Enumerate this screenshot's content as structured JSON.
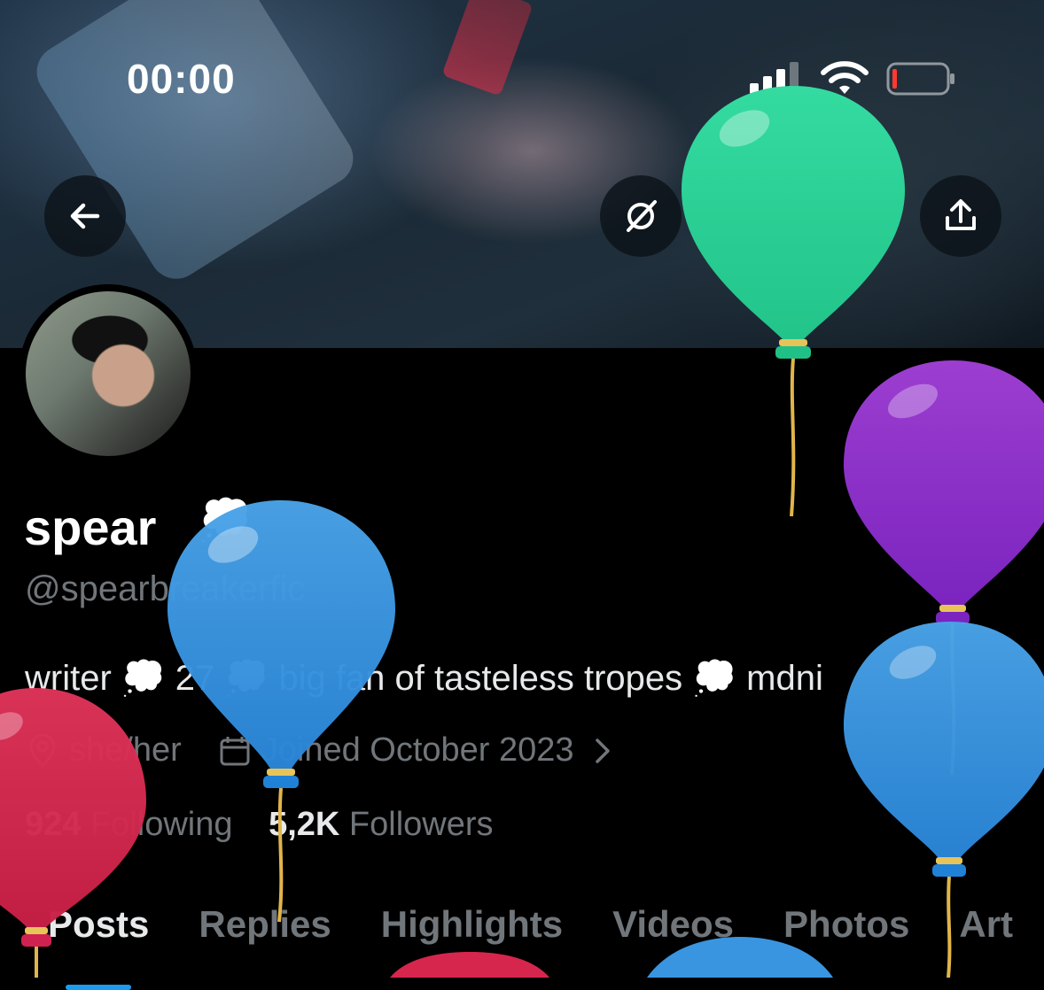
{
  "status_bar": {
    "time": "00:00"
  },
  "profile": {
    "name": "spear",
    "name_emoji": "💭",
    "handle": "@spearbreakerfic",
    "bio": "writer 💭 27 💭 big fan of tasteless tropes 💭 mdni",
    "pronouns": "she/her",
    "joined": "Joined October 2023",
    "following_count": "924",
    "following_label": "Following",
    "followers_count": "5,2K",
    "followers_label": "Followers"
  },
  "tabs": [
    "Posts",
    "Replies",
    "Highlights",
    "Videos",
    "Photos",
    "Art"
  ],
  "colors": {
    "accent": "#1d9bf0",
    "balloon_green": "#2fd498",
    "balloon_blue": "#3a95e0",
    "balloon_purple": "#8a2fc7",
    "balloon_red": "#d7264d"
  },
  "icons": {
    "back": "arrow-left-icon",
    "grok": "slashed-circle-icon",
    "search": "search-icon",
    "edit": "pencil-icon",
    "share": "share-icon",
    "location": "location-pin-icon",
    "calendar": "calendar-icon"
  }
}
